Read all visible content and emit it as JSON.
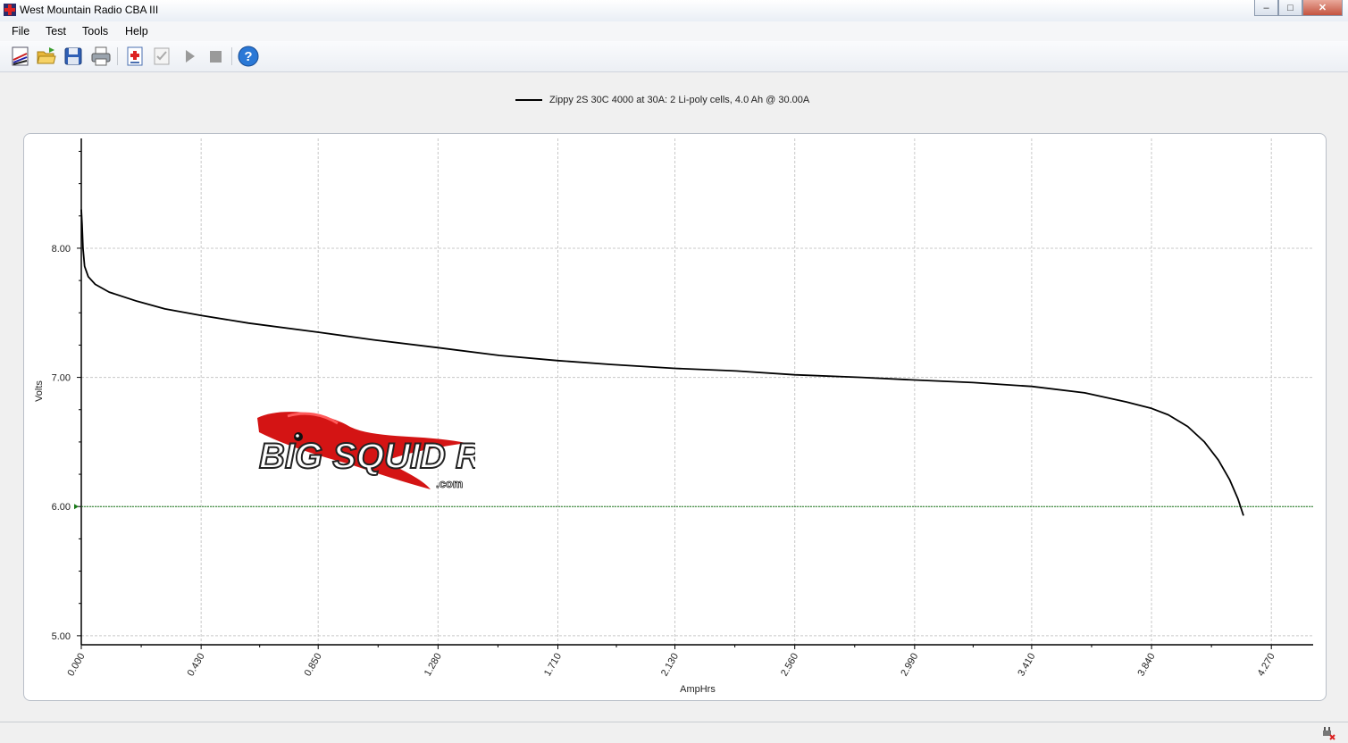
{
  "window": {
    "title": "West Mountain Radio CBA III"
  },
  "menu": [
    "File",
    "Test",
    "Tools",
    "Help"
  ],
  "toolbar": {
    "buttons": [
      {
        "name": "new-graph-icon"
      },
      {
        "name": "open-folder-icon"
      },
      {
        "name": "save-disk-icon"
      },
      {
        "name": "printer-icon"
      },
      {
        "name": "add-test-icon"
      },
      {
        "name": "checklist-icon"
      },
      {
        "name": "play-icon"
      },
      {
        "name": "stop-icon"
      },
      {
        "name": "help-icon"
      }
    ]
  },
  "chart_data": {
    "type": "line",
    "legend": "Zippy 2S 30C 4000 at 30A: 2 Li-poly cells, 4.0 Ah @ 30.00A",
    "xlabel": "AmpHrs",
    "ylabel": "Volts",
    "xlim": [
      0,
      4.42
    ],
    "ylim": [
      4.93,
      8.85
    ],
    "x_ticks": [
      "0.000",
      "0.430",
      "0.850",
      "1.280",
      "1.710",
      "2.130",
      "2.560",
      "2.990",
      "3.410",
      "3.840",
      "4.270"
    ],
    "x_tick_values": [
      0,
      0.43,
      0.85,
      1.28,
      1.71,
      2.13,
      2.56,
      2.99,
      3.41,
      3.84,
      4.27
    ],
    "y_ticks": [
      "5.00",
      "6.00",
      "7.00",
      "8.00"
    ],
    "y_tick_values": [
      5,
      6,
      7,
      8
    ],
    "cutoff_voltage": 6.0,
    "grid": true,
    "series": [
      {
        "color": "#000000",
        "points": [
          [
            0.0,
            8.3
          ],
          [
            0.003,
            8.18
          ],
          [
            0.006,
            8.0
          ],
          [
            0.012,
            7.86
          ],
          [
            0.025,
            7.78
          ],
          [
            0.05,
            7.72
          ],
          [
            0.1,
            7.66
          ],
          [
            0.2,
            7.59
          ],
          [
            0.3,
            7.53
          ],
          [
            0.43,
            7.48
          ],
          [
            0.6,
            7.42
          ],
          [
            0.85,
            7.35
          ],
          [
            1.05,
            7.29
          ],
          [
            1.28,
            7.23
          ],
          [
            1.5,
            7.17
          ],
          [
            1.71,
            7.13
          ],
          [
            1.9,
            7.1
          ],
          [
            2.13,
            7.07
          ],
          [
            2.35,
            7.05
          ],
          [
            2.56,
            7.02
          ],
          [
            2.8,
            7.0
          ],
          [
            2.99,
            6.98
          ],
          [
            3.2,
            6.96
          ],
          [
            3.41,
            6.93
          ],
          [
            3.6,
            6.88
          ],
          [
            3.75,
            6.81
          ],
          [
            3.84,
            6.76
          ],
          [
            3.9,
            6.71
          ],
          [
            3.97,
            6.62
          ],
          [
            4.03,
            6.5
          ],
          [
            4.08,
            6.36
          ],
          [
            4.12,
            6.21
          ],
          [
            4.15,
            6.06
          ],
          [
            4.17,
            5.93
          ]
        ]
      }
    ],
    "cutoff_color": "#1a7a1a"
  },
  "watermark": {
    "brand": "BIG SQUID RC",
    "suffix": ".com"
  }
}
